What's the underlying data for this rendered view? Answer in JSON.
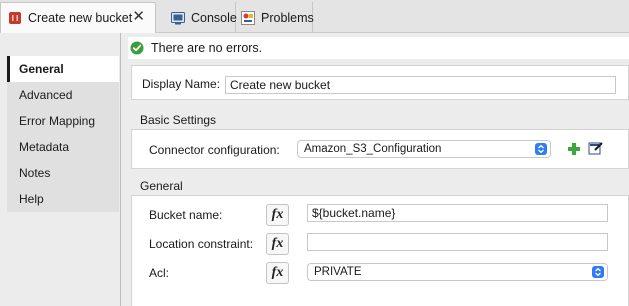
{
  "tabs": [
    {
      "label": "Create new bucket",
      "icon": "mule-connector-icon",
      "active": true
    },
    {
      "label": "Console",
      "icon": "console-icon",
      "active": false
    },
    {
      "label": "Problems",
      "icon": "problems-icon",
      "active": false
    }
  ],
  "close_glyph": "✕",
  "nav": {
    "items": [
      {
        "label": "General",
        "active": true
      },
      {
        "label": "Advanced"
      },
      {
        "label": "Error Mapping"
      },
      {
        "label": "Metadata"
      },
      {
        "label": "Notes"
      },
      {
        "label": "Help"
      }
    ]
  },
  "status": {
    "text": "There are no errors.",
    "color": "#3a9e3a"
  },
  "display_name": {
    "label": "Display Name:",
    "value": "Create new bucket"
  },
  "basic_settings": {
    "title": "Basic Settings",
    "connector_label": "Connector configuration:",
    "connector_value": "Amazon_S3_Configuration"
  },
  "general": {
    "title": "General",
    "bucket_label": "Bucket name:",
    "bucket_value": "${bucket.name}",
    "location_label": "Location constraint:",
    "location_value": "",
    "acl_label": "Acl:",
    "acl_value": "PRIVATE"
  },
  "fx_label": "fx",
  "colors": {
    "accent": "#2f7cf6",
    "add_green": "#3da63d"
  }
}
